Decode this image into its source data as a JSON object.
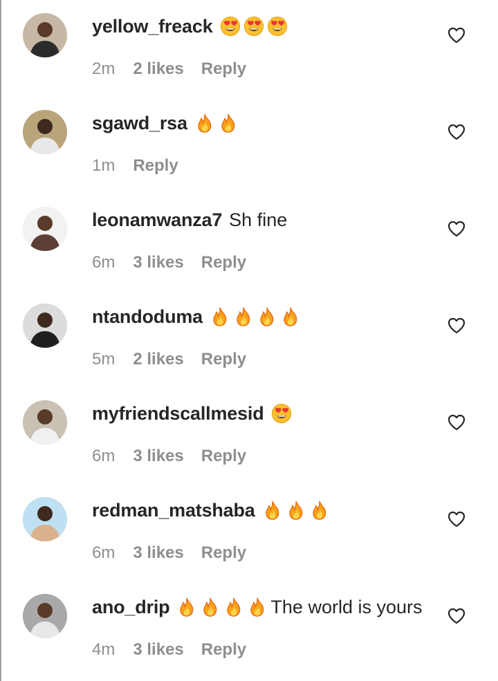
{
  "comments": [
    {
      "username": "yellow_freack",
      "emojis": [
        "heart-eyes",
        "heart-eyes",
        "heart-eyes"
      ],
      "text": "",
      "time": "2m",
      "likes": "2 likes",
      "reply": "Reply",
      "avatar_bg": "#c7b8a6"
    },
    {
      "username": "sgawd_rsa",
      "emojis": [
        "fire",
        "fire"
      ],
      "text": "",
      "time": "1m",
      "likes": "",
      "reply": "Reply",
      "avatar_bg": "#b9a57a"
    },
    {
      "username": "leonamwanza7",
      "emojis": [],
      "text": "Sh fine",
      "time": "6m",
      "likes": "3 likes",
      "reply": "Reply",
      "avatar_bg": "#f2f2f2"
    },
    {
      "username": "ntandoduma",
      "emojis": [
        "fire",
        "fire",
        "fire",
        "fire"
      ],
      "text": "",
      "time": "5m",
      "likes": "2 likes",
      "reply": "Reply",
      "avatar_bg": "#dcdcdc"
    },
    {
      "username": "myfriendscallmesid",
      "emojis": [
        "heart-eyes"
      ],
      "text": "",
      "time": "6m",
      "likes": "3 likes",
      "reply": "Reply",
      "avatar_bg": "#c9c2b4"
    },
    {
      "username": "redman_matshaba",
      "emojis": [
        "fire",
        "fire",
        "fire"
      ],
      "text": "",
      "time": "6m",
      "likes": "3 likes",
      "reply": "Reply",
      "avatar_bg": "#bfe0f2"
    },
    {
      "username": "ano_drip",
      "emojis": [
        "fire",
        "fire",
        "fire",
        "fire"
      ],
      "text": "The world is yours",
      "time": "4m",
      "likes": "3 likes",
      "reply": "Reply",
      "avatar_bg": "#a9a9a9"
    }
  ],
  "icons": {
    "like": "heart-outline-icon",
    "fire": "fire-emoji",
    "heart_eyes": "heart-eyes-emoji"
  },
  "colors": {
    "text": "#262626",
    "meta": "#8e8e8e",
    "background": "#ffffff"
  }
}
